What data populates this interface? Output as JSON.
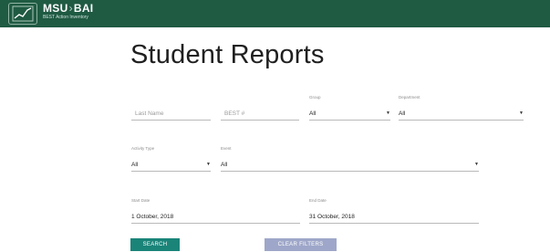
{
  "header": {
    "brand_left": "MSU",
    "brand_sep": "›",
    "brand_right": "BAI",
    "subtitle": "BEST Action Inventory",
    "logo_icon": "chart-logo-icon",
    "bg_color": "#1f5a43"
  },
  "page_title": "Student Reports",
  "filters": {
    "last_name": {
      "placeholder": "Last Name"
    },
    "best_number": {
      "placeholder": "BEST #"
    },
    "group": {
      "label": "Group",
      "value": "All"
    },
    "department": {
      "label": "Department",
      "value": "All"
    },
    "activity_type": {
      "label": "Activity Type",
      "value": "All"
    },
    "event": {
      "label": "Event",
      "value": "All"
    },
    "start_date": {
      "label": "Start Date",
      "value": "1 October, 2018"
    },
    "end_date": {
      "label": "End Date",
      "value": "31 October, 2018"
    }
  },
  "caret": "▼",
  "buttons": {
    "search": "SEARCH",
    "clear": "CLEAR FILTERS",
    "search_color": "#1a8479",
    "clear_color": "#9ea7c9"
  }
}
